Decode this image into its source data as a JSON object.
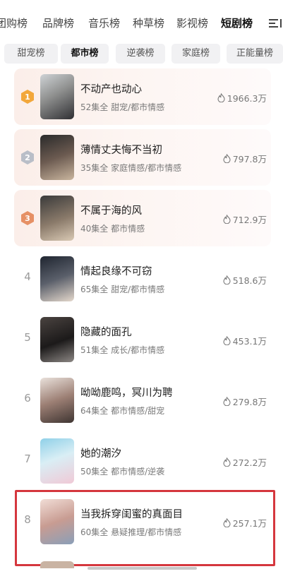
{
  "top_tabs": [
    "团购榜",
    "品牌榜",
    "音乐榜",
    "种草榜",
    "影视榜",
    "短剧榜"
  ],
  "top_active": "短剧榜",
  "sub_tabs": [
    "甜宠榜",
    "都市榜",
    "逆袭榜",
    "家庭榜",
    "正能量榜"
  ],
  "sub_active": "都市榜",
  "colors": {
    "gold": "#f2a73b",
    "silver": "#b9bec8",
    "bronze": "#e69065",
    "highlight": "#d5373e"
  },
  "items": [
    {
      "rank": "1",
      "title": "不动产也动心",
      "episodes": "52集全",
      "tags": "甜宠/都市情感",
      "heat": "1966.3万"
    },
    {
      "rank": "2",
      "title": "薄情丈夫悔不当初",
      "episodes": "35集全",
      "tags": "家庭情感/都市情感",
      "heat": "797.8万"
    },
    {
      "rank": "3",
      "title": "不属于海的风",
      "episodes": "40集全",
      "tags": "都市情感",
      "heat": "712.9万"
    },
    {
      "rank": "4",
      "title": "情起良缘不可窃",
      "episodes": "65集全",
      "tags": "甜宠/都市情感",
      "heat": "518.6万"
    },
    {
      "rank": "5",
      "title": "隐藏的面孔",
      "episodes": "51集全",
      "tags": "成长/都市情感",
      "heat": "453.1万"
    },
    {
      "rank": "6",
      "title": "呦呦鹿鸣，冥川为聘",
      "episodes": "64集全",
      "tags": "都市情感/甜宠",
      "heat": "279.8万"
    },
    {
      "rank": "7",
      "title": "她的潮汐",
      "episodes": "50集全",
      "tags": "都市情感/逆袭",
      "heat": "272.2万"
    },
    {
      "rank": "8",
      "title": "当我拆穿闺蜜的真面目",
      "episodes": "60集全",
      "tags": "悬疑推理/都市情感",
      "heat": "257.1万"
    }
  ]
}
